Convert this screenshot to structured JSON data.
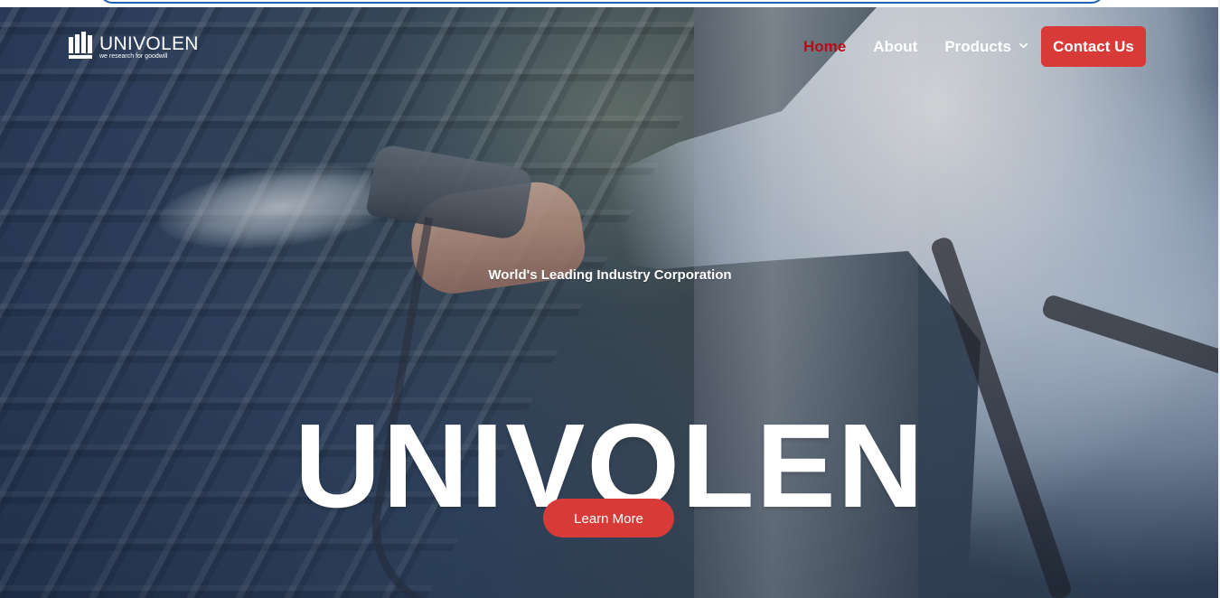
{
  "site": {
    "logo": {
      "title": "UNIVOLEN",
      "tagline": "we research for goodwill",
      "icon": "univolen-logo-icon"
    },
    "nav": {
      "items": [
        {
          "label": "Home",
          "active": true
        },
        {
          "label": "About",
          "active": false
        },
        {
          "label": "Products",
          "active": false,
          "dropdown_icon": "chevron-down-icon"
        }
      ],
      "contact_label": "Contact Us"
    },
    "hero": {
      "eyebrow": "World's Leading Industry Corporation",
      "title": "UNIVOLEN",
      "button_label": "Learn More"
    }
  },
  "colors": {
    "active_nav": "#b10f18",
    "accent_button": "#d83a38",
    "frame_outline": "#1f5fb8",
    "text_light": "#ffffff"
  }
}
